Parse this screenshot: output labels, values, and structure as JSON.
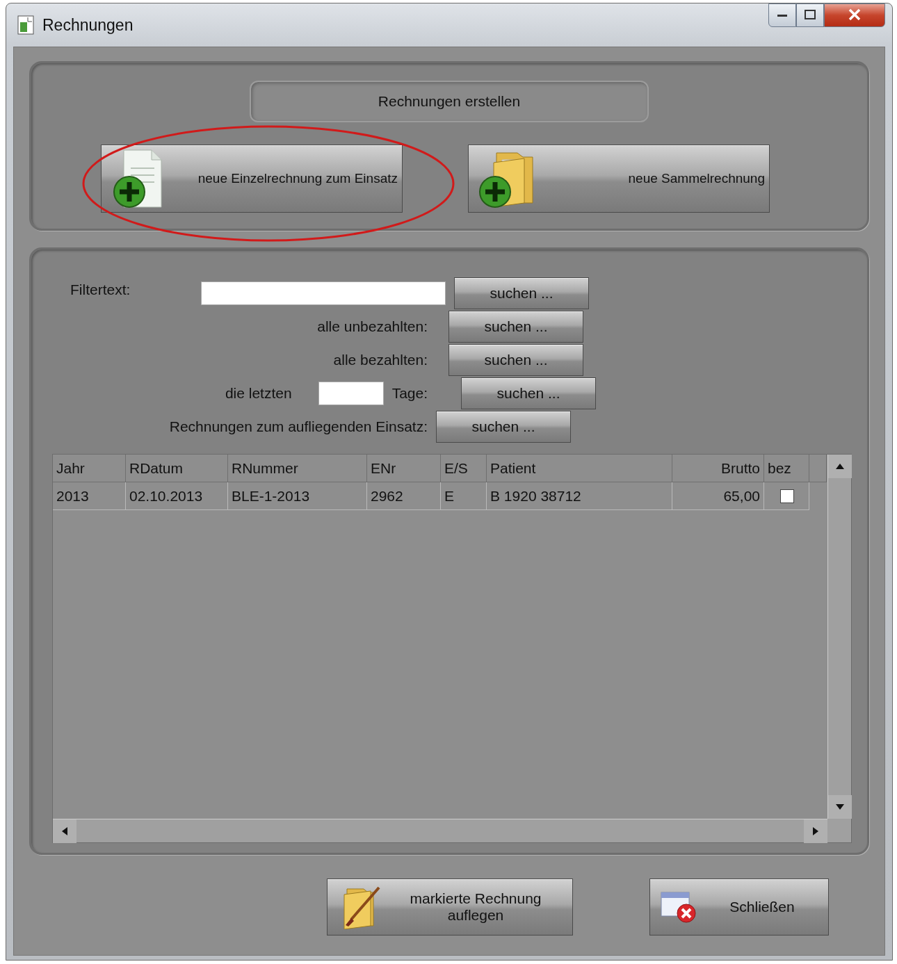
{
  "window": {
    "title": "Rechnungen"
  },
  "create_panel": {
    "heading": "Rechnungen erstellen",
    "buttons": [
      {
        "label": "neue Einzelrechnung zum Einsatz",
        "kind": "document"
      },
      {
        "label": "neue Sammelrechnung",
        "kind": "folder"
      }
    ]
  },
  "filters": [
    {
      "kind": "text",
      "label": "Filtertext:",
      "button": "suchen ..."
    },
    {
      "kind": "plain",
      "label": "alle unbezahlten:",
      "button": "suchen ..."
    },
    {
      "kind": "plain",
      "label": "alle bezahlten:",
      "button": "suchen ..."
    },
    {
      "kind": "days",
      "label": "die letzten",
      "suffix": "Tage:",
      "button": "suchen ..."
    },
    {
      "kind": "plain",
      "label": "Rechnungen zum aufliegenden Einsatz:",
      "button": "suchen ..."
    }
  ],
  "table": {
    "columns": [
      "Jahr",
      "RDatum",
      "RNummer",
      "ENr",
      "E/S",
      "Patient",
      "Brutto",
      "bez"
    ],
    "rows": [
      {
        "cells": [
          "2013",
          "02.10.2013",
          "BLE-1-2013",
          "2962",
          "E",
          "B 1920 38712",
          "65,00"
        ],
        "paid": false
      }
    ]
  },
  "footer_buttons": [
    {
      "label": "markierte Rechnung auflegen",
      "kind": "assign"
    },
    {
      "label": "Schließen",
      "kind": "close"
    }
  ]
}
